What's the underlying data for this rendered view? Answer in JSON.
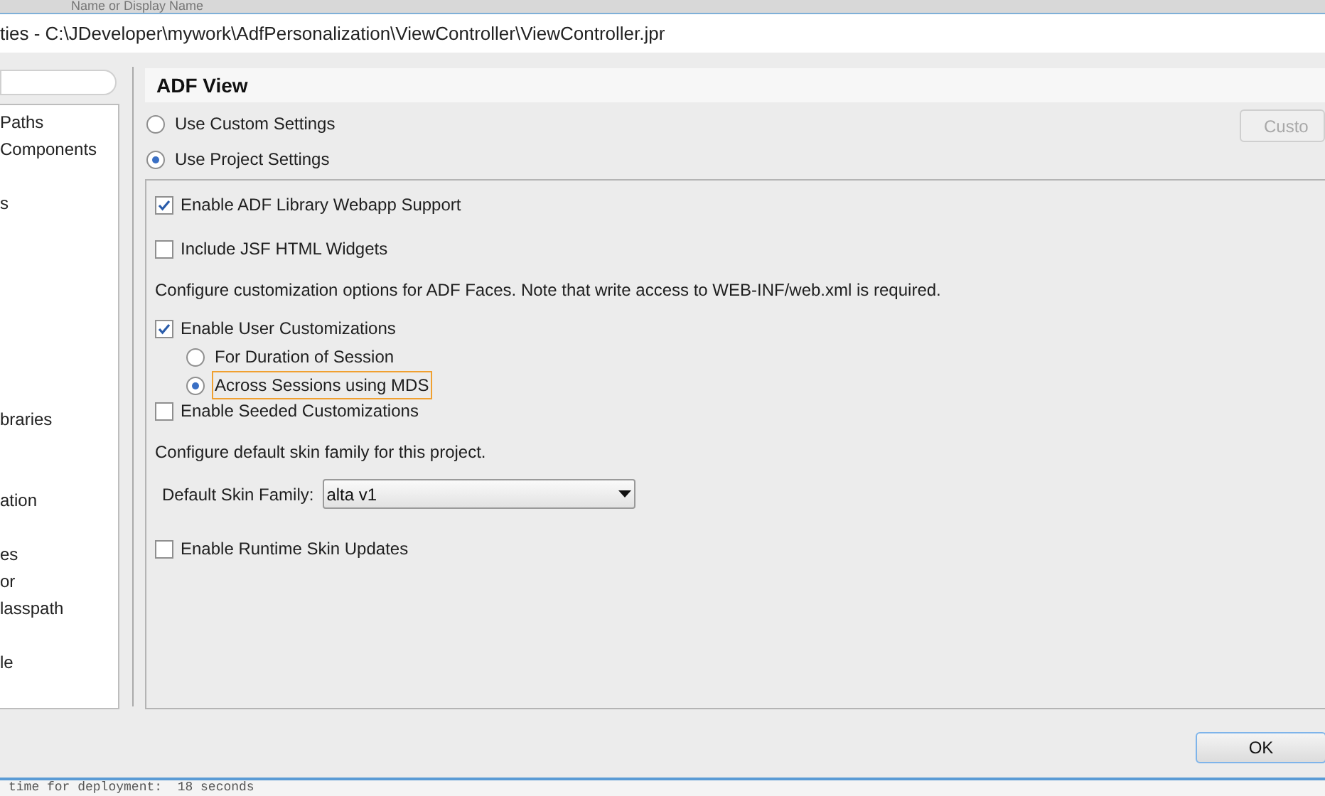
{
  "background_top": {
    "text": "Name or Display Name"
  },
  "window": {
    "title": "ties - C:\\JDeveloper\\mywork\\AdfPersonalization\\ViewController\\ViewController.jpr"
  },
  "sidebar": {
    "items": [
      {
        "label": "Paths"
      },
      {
        "label": "Components"
      },
      {
        "label": "s"
      },
      {
        "label": "braries"
      },
      {
        "label": "ation"
      },
      {
        "label": "es"
      },
      {
        "label": "or"
      },
      {
        "label": "lasspath"
      },
      {
        "label": "le"
      }
    ]
  },
  "page": {
    "title": "ADF View",
    "scope": [
      {
        "label": "Use Custom Settings",
        "selected": false
      },
      {
        "label": "Use Project Settings",
        "selected": true
      }
    ],
    "customize_button": {
      "label": "Custo",
      "disabled": true
    },
    "settings": [
      {
        "kind": "checkbox",
        "label": "Enable ADF Library Webapp Support",
        "checked": true
      },
      {
        "kind": "checkbox",
        "label": "Include JSF HTML Widgets",
        "checked": false
      },
      {
        "kind": "note",
        "label": "Configure customization options for ADF Faces. Note that write access to WEB-INF/web.xml is required."
      },
      {
        "kind": "checkbox",
        "label": "Enable User Customizations",
        "checked": true
      },
      {
        "kind": "radio",
        "label": "For Duration of Session",
        "selected": false,
        "focused": false
      },
      {
        "kind": "radio",
        "label": "Across Sessions using MDS",
        "selected": true,
        "focused": true
      },
      {
        "kind": "checkbox",
        "label": "Enable Seeded Customizations",
        "checked": false
      },
      {
        "kind": "note",
        "label": "Configure default skin family for this project."
      },
      {
        "kind": "select",
        "label": "Default Skin Family:",
        "value": "alta v1"
      },
      {
        "kind": "checkbox",
        "label": "Enable Runtime Skin Updates",
        "checked": false
      }
    ]
  },
  "buttons": [
    "OK"
  ],
  "background_bottom": {
    "text": "time for deployment:  18 seconds"
  }
}
